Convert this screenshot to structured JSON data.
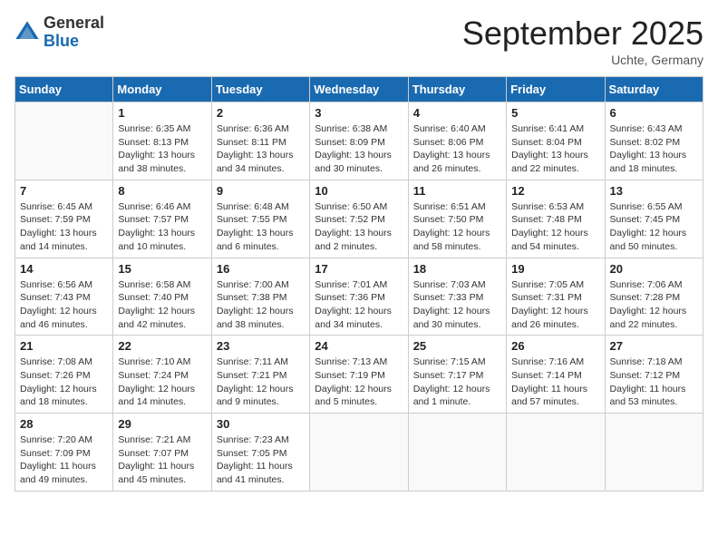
{
  "header": {
    "logo_general": "General",
    "logo_blue": "Blue",
    "month_title": "September 2025",
    "location": "Uchte, Germany"
  },
  "days_of_week": [
    "Sunday",
    "Monday",
    "Tuesday",
    "Wednesday",
    "Thursday",
    "Friday",
    "Saturday"
  ],
  "weeks": [
    [
      {
        "day": "",
        "info": ""
      },
      {
        "day": "1",
        "info": "Sunrise: 6:35 AM\nSunset: 8:13 PM\nDaylight: 13 hours\nand 38 minutes."
      },
      {
        "day": "2",
        "info": "Sunrise: 6:36 AM\nSunset: 8:11 PM\nDaylight: 13 hours\nand 34 minutes."
      },
      {
        "day": "3",
        "info": "Sunrise: 6:38 AM\nSunset: 8:09 PM\nDaylight: 13 hours\nand 30 minutes."
      },
      {
        "day": "4",
        "info": "Sunrise: 6:40 AM\nSunset: 8:06 PM\nDaylight: 13 hours\nand 26 minutes."
      },
      {
        "day": "5",
        "info": "Sunrise: 6:41 AM\nSunset: 8:04 PM\nDaylight: 13 hours\nand 22 minutes."
      },
      {
        "day": "6",
        "info": "Sunrise: 6:43 AM\nSunset: 8:02 PM\nDaylight: 13 hours\nand 18 minutes."
      }
    ],
    [
      {
        "day": "7",
        "info": "Sunrise: 6:45 AM\nSunset: 7:59 PM\nDaylight: 13 hours\nand 14 minutes."
      },
      {
        "day": "8",
        "info": "Sunrise: 6:46 AM\nSunset: 7:57 PM\nDaylight: 13 hours\nand 10 minutes."
      },
      {
        "day": "9",
        "info": "Sunrise: 6:48 AM\nSunset: 7:55 PM\nDaylight: 13 hours\nand 6 minutes."
      },
      {
        "day": "10",
        "info": "Sunrise: 6:50 AM\nSunset: 7:52 PM\nDaylight: 13 hours\nand 2 minutes."
      },
      {
        "day": "11",
        "info": "Sunrise: 6:51 AM\nSunset: 7:50 PM\nDaylight: 12 hours\nand 58 minutes."
      },
      {
        "day": "12",
        "info": "Sunrise: 6:53 AM\nSunset: 7:48 PM\nDaylight: 12 hours\nand 54 minutes."
      },
      {
        "day": "13",
        "info": "Sunrise: 6:55 AM\nSunset: 7:45 PM\nDaylight: 12 hours\nand 50 minutes."
      }
    ],
    [
      {
        "day": "14",
        "info": "Sunrise: 6:56 AM\nSunset: 7:43 PM\nDaylight: 12 hours\nand 46 minutes."
      },
      {
        "day": "15",
        "info": "Sunrise: 6:58 AM\nSunset: 7:40 PM\nDaylight: 12 hours\nand 42 minutes."
      },
      {
        "day": "16",
        "info": "Sunrise: 7:00 AM\nSunset: 7:38 PM\nDaylight: 12 hours\nand 38 minutes."
      },
      {
        "day": "17",
        "info": "Sunrise: 7:01 AM\nSunset: 7:36 PM\nDaylight: 12 hours\nand 34 minutes."
      },
      {
        "day": "18",
        "info": "Sunrise: 7:03 AM\nSunset: 7:33 PM\nDaylight: 12 hours\nand 30 minutes."
      },
      {
        "day": "19",
        "info": "Sunrise: 7:05 AM\nSunset: 7:31 PM\nDaylight: 12 hours\nand 26 minutes."
      },
      {
        "day": "20",
        "info": "Sunrise: 7:06 AM\nSunset: 7:28 PM\nDaylight: 12 hours\nand 22 minutes."
      }
    ],
    [
      {
        "day": "21",
        "info": "Sunrise: 7:08 AM\nSunset: 7:26 PM\nDaylight: 12 hours\nand 18 minutes."
      },
      {
        "day": "22",
        "info": "Sunrise: 7:10 AM\nSunset: 7:24 PM\nDaylight: 12 hours\nand 14 minutes."
      },
      {
        "day": "23",
        "info": "Sunrise: 7:11 AM\nSunset: 7:21 PM\nDaylight: 12 hours\nand 9 minutes."
      },
      {
        "day": "24",
        "info": "Sunrise: 7:13 AM\nSunset: 7:19 PM\nDaylight: 12 hours\nand 5 minutes."
      },
      {
        "day": "25",
        "info": "Sunrise: 7:15 AM\nSunset: 7:17 PM\nDaylight: 12 hours\nand 1 minute."
      },
      {
        "day": "26",
        "info": "Sunrise: 7:16 AM\nSunset: 7:14 PM\nDaylight: 11 hours\nand 57 minutes."
      },
      {
        "day": "27",
        "info": "Sunrise: 7:18 AM\nSunset: 7:12 PM\nDaylight: 11 hours\nand 53 minutes."
      }
    ],
    [
      {
        "day": "28",
        "info": "Sunrise: 7:20 AM\nSunset: 7:09 PM\nDaylight: 11 hours\nand 49 minutes."
      },
      {
        "day": "29",
        "info": "Sunrise: 7:21 AM\nSunset: 7:07 PM\nDaylight: 11 hours\nand 45 minutes."
      },
      {
        "day": "30",
        "info": "Sunrise: 7:23 AM\nSunset: 7:05 PM\nDaylight: 11 hours\nand 41 minutes."
      },
      {
        "day": "",
        "info": ""
      },
      {
        "day": "",
        "info": ""
      },
      {
        "day": "",
        "info": ""
      },
      {
        "day": "",
        "info": ""
      }
    ]
  ]
}
